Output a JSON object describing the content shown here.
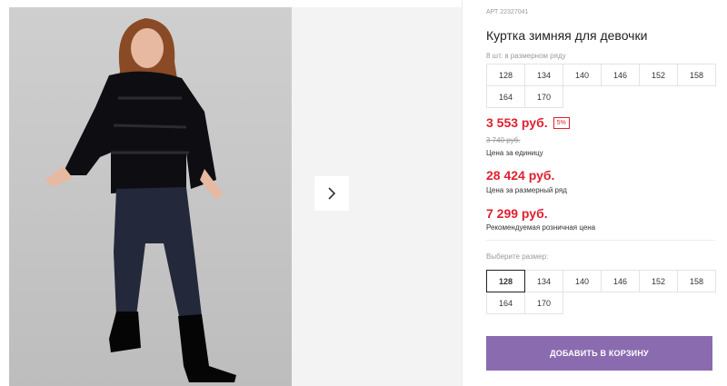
{
  "product": {
    "article": "АРТ 22327041",
    "title": "Куртка зимняя для девочки",
    "sizes_note": "8 шт. в размерном ряду",
    "size_range": [
      "128",
      "134",
      "140",
      "146",
      "152",
      "158",
      "164",
      "170"
    ],
    "price": "3 553 руб.",
    "discount_badge": "5%",
    "old_price": "3 740 руб.",
    "price_unit_label": "Цена за единицу",
    "set_price": "28 424 руб.",
    "set_price_label": "Цена за размерный ряд",
    "rrp": "7 299 руб.",
    "rrp_label": "Рекомендуемая розничная цена"
  },
  "size_selector": {
    "label": "Выберите размер:",
    "options": [
      "128",
      "134",
      "140",
      "146",
      "152",
      "158",
      "164",
      "170"
    ],
    "selected": "128"
  },
  "actions": {
    "add_to_cart": "ДОБАВИТЬ В КОРЗИНУ"
  },
  "gallery": {
    "next_icon": "chevron-right-icon"
  },
  "colors": {
    "accent_price": "#e02030",
    "button_bg": "#8a6bb0",
    "photo_bg": "#c9c9c9"
  }
}
